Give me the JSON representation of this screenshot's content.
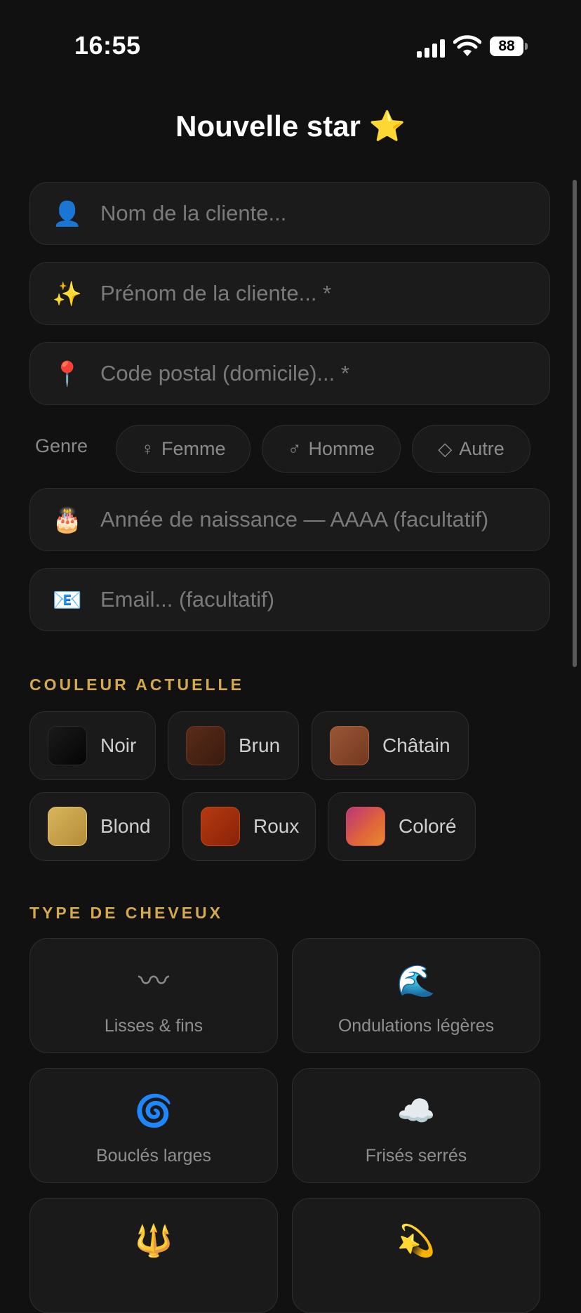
{
  "status": {
    "time": "16:55",
    "battery": "88"
  },
  "title": "Nouvelle star ⭐",
  "fields": {
    "nom": {
      "icon": "👤",
      "placeholder": "Nom de la cliente..."
    },
    "prenom": {
      "icon": "✨",
      "placeholder": "Prénom de la cliente... *"
    },
    "cp": {
      "icon": "📍",
      "placeholder": "Code postal (domicile)... *"
    },
    "annee": {
      "icon": "🎂",
      "placeholder": "Année de naissance — AAAA (facultatif)"
    },
    "email": {
      "icon": "📧",
      "placeholder": "Email... (facultatif)"
    }
  },
  "genre": {
    "label": "Genre",
    "options": [
      {
        "glyph": "♀",
        "label": "Femme"
      },
      {
        "glyph": "♂",
        "label": "Homme"
      },
      {
        "glyph": "◇",
        "label": "Autre"
      }
    ]
  },
  "couleur": {
    "title": "COULEUR ACTUELLE",
    "options": [
      {
        "label": "Noir",
        "color": "#0a0a0a"
      },
      {
        "label": "Brun",
        "color": "#4a2415"
      },
      {
        "label": "Châtain",
        "color": "#8a4a30"
      },
      {
        "label": "Blond",
        "color": "#c9a450"
      },
      {
        "label": "Roux",
        "color": "#a3300c"
      },
      {
        "label": "Coloré",
        "color": "#d9556a"
      }
    ]
  },
  "cheveux": {
    "title": "TYPE DE CHEVEUX",
    "options": [
      {
        "icon": "〰",
        "label": "Lisses & fins"
      },
      {
        "icon": "🌊",
        "label": "Ondulations légères"
      },
      {
        "icon": "🌀",
        "label": "Bouclés larges"
      },
      {
        "icon": "☁️",
        "label": "Frisés serrés"
      },
      {
        "icon": "🔱",
        "label": ""
      },
      {
        "icon": "💫",
        "label": ""
      }
    ]
  }
}
